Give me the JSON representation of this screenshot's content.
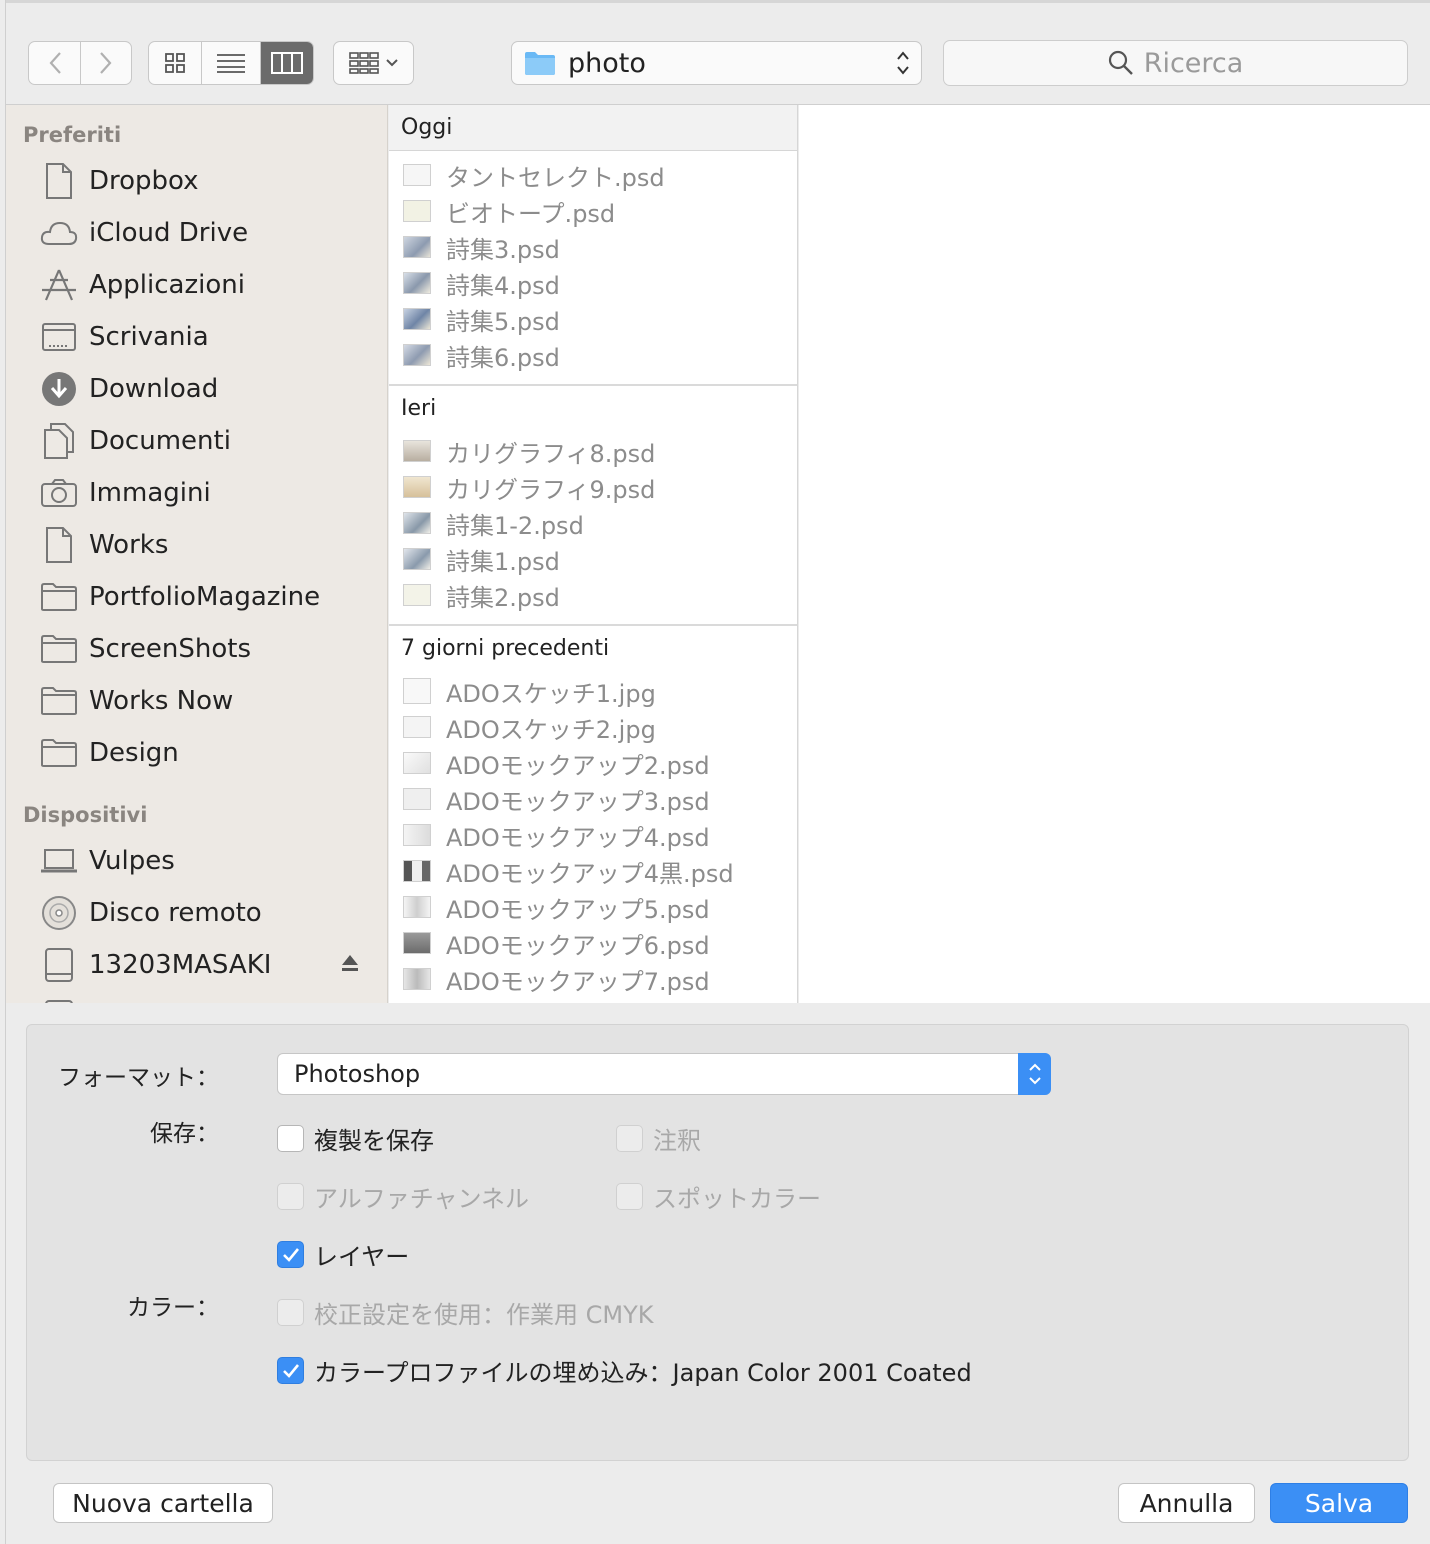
{
  "toolbar": {
    "path_label": "photo",
    "search_placeholder": "Ricerca"
  },
  "sidebar": {
    "favorites_header": "Preferiti",
    "favorites": [
      {
        "label": "Dropbox",
        "icon": "document-icon"
      },
      {
        "label": "iCloud Drive",
        "icon": "cloud-icon"
      },
      {
        "label": "Applicazioni",
        "icon": "applications-icon"
      },
      {
        "label": "Scrivania",
        "icon": "desktop-icon"
      },
      {
        "label": "Download",
        "icon": "download-icon"
      },
      {
        "label": "Documenti",
        "icon": "documents-icon"
      },
      {
        "label": "Immagini",
        "icon": "camera-icon"
      },
      {
        "label": "Works",
        "icon": "document-icon"
      },
      {
        "label": "PortfolioMagazine",
        "icon": "folder-icon"
      },
      {
        "label": "ScreenShots",
        "icon": "folder-icon"
      },
      {
        "label": "Works Now",
        "icon": "folder-icon"
      },
      {
        "label": "Design",
        "icon": "folder-icon"
      }
    ],
    "devices_header": "Dispositivi",
    "devices": [
      {
        "label": "Vulpes",
        "icon": "laptop-icon"
      },
      {
        "label": "Disco remoto",
        "icon": "disc-icon"
      },
      {
        "label": "13203MASAKI",
        "icon": "drive-icon"
      }
    ]
  },
  "browser": {
    "groups": [
      {
        "header": "Oggi",
        "files": [
          "タントセレクト.psd",
          "ビオトープ.psd",
          "詩集3.psd",
          "詩集4.psd",
          "詩集5.psd",
          "詩集6.psd"
        ]
      },
      {
        "header": "Ieri",
        "files": [
          "カリグラフィ8.psd",
          "カリグラフィ9.psd",
          "詩集1-2.psd",
          "詩集1.psd",
          "詩集2.psd"
        ]
      },
      {
        "header": "7 giorni precedenti",
        "files": [
          "ADOスケッチ1.jpg",
          "ADOスケッチ2.jpg",
          "ADOモックアップ2.psd",
          "ADOモックアップ3.psd",
          "ADOモックアップ4.psd",
          "ADOモックアップ4黒.psd",
          "ADOモックアップ5.psd",
          "ADOモックアップ6.psd",
          "ADOモックアップ7.psd"
        ]
      }
    ]
  },
  "options": {
    "format_label": "フォーマット：",
    "format_value": "Photoshop",
    "save_label": "保存：",
    "color_label": "カラー：",
    "checkboxes": {
      "duplicate": "複製を保存",
      "notes": "注釈",
      "alpha": "アルファチャンネル",
      "spot": "スポットカラー",
      "layers": "レイヤー",
      "proof": "校正設定を使用：作業用 CMYK",
      "profile": "カラープロファイルの埋め込み：Japan Color 2001 Coated"
    }
  },
  "buttons": {
    "new_folder": "Nuova cartella",
    "cancel": "Annulla",
    "save": "Salva"
  },
  "colors": {
    "accent": "#3b8ff5"
  }
}
